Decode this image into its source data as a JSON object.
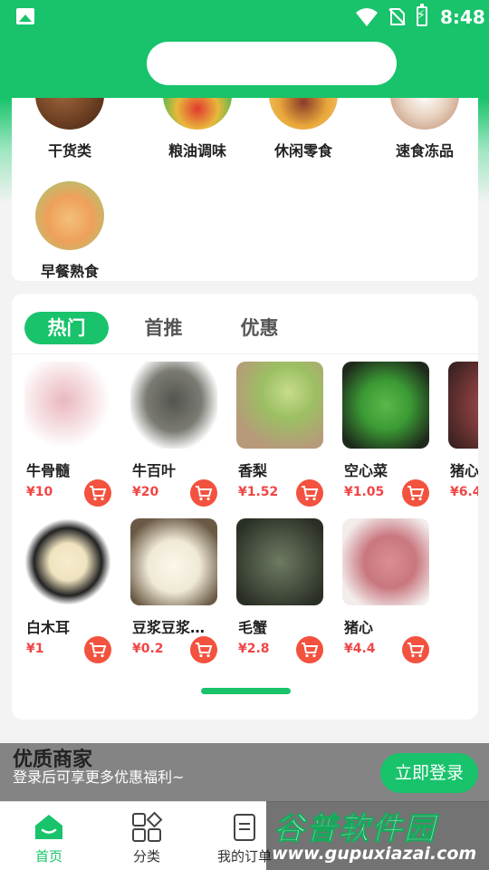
{
  "status_bar": {
    "time": "8:48"
  },
  "categories": [
    {
      "label": "干货类",
      "color": "#6b3e22"
    },
    {
      "label": "粮油调味",
      "color": "#2fb84f"
    },
    {
      "label": "休闲零食",
      "color": "#e9a73a"
    },
    {
      "label": "速食冻品",
      "color": "#e8d3c0"
    },
    {
      "label": "早餐熟食",
      "color": "#eea05a"
    }
  ],
  "tabs": [
    "热门",
    "首推",
    "优惠"
  ],
  "products": [
    {
      "name": "牛骨髓",
      "price": "¥10",
      "color": "#e9b8bf"
    },
    {
      "name": "牛百叶",
      "price": "¥20",
      "color": "#6a6a64"
    },
    {
      "name": "香梨",
      "price": "¥1.52",
      "color": "#9cbf63"
    },
    {
      "name": "空心菜",
      "price": "¥1.05",
      "color": "#3b9a34"
    },
    {
      "name": "猪心",
      "price": "¥6.4",
      "color": "#7e3b3b"
    },
    {
      "name": "白木耳",
      "price": "¥1",
      "color": "#f0e3bf"
    },
    {
      "name": "豆浆豆浆…",
      "price": "¥0.2",
      "color": "#efe9d6"
    },
    {
      "name": "毛蟹",
      "price": "¥2.8",
      "color": "#4b5443"
    },
    {
      "name": "猪心",
      "price": "¥4.4",
      "color": "#c9777f"
    }
  ],
  "login_bar": {
    "title": "优质商家",
    "subtitle": "登录后可享更多优惠福利~",
    "button": "立即登录"
  },
  "nav": [
    {
      "label": "首页",
      "icon": "home-icon"
    },
    {
      "label": "分类",
      "icon": "category-icon"
    },
    {
      "label": "我的订单",
      "icon": "order-icon"
    }
  ],
  "watermark": {
    "title": "谷普软件园",
    "url": "www.gupuxiazai.com"
  },
  "colors": {
    "primary": "#18c36b",
    "price": "#f04646",
    "cart": "#f3523e"
  }
}
